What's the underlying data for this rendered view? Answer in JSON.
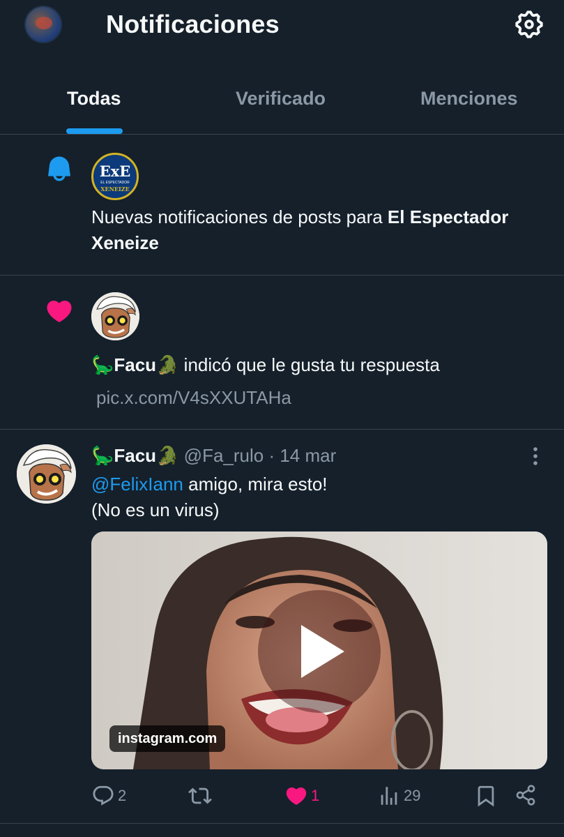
{
  "header": {
    "title": "Notificaciones",
    "avatar_icon": "user-avatar",
    "settings_icon": "gear-icon"
  },
  "tabs": [
    {
      "label": "Todas",
      "active": true
    },
    {
      "label": "Verificado",
      "active": false
    },
    {
      "label": "Menciones",
      "active": false
    }
  ],
  "notifications": [
    {
      "type": "new-posts",
      "icon": "bell-icon",
      "account_logo_text": "ExE",
      "account_logo_small": "EL ESPECTADOR",
      "account_logo_name": "XENEIZE",
      "text_prefix": "Nuevas notificaciones de posts para ",
      "text_account": "El Espectador Xeneize"
    },
    {
      "type": "like",
      "icon": "heart-icon",
      "user_display": "🦕Facu🐊",
      "text": " indicó que le gusta tu respuesta",
      "link": "pic.x.com/V4sXXUTAHa"
    }
  ],
  "tweet": {
    "display_name": "🦕Facu🐊",
    "handle": "@Fa_rulo",
    "separator": " · ",
    "date": "14 mar",
    "mention": "@FelixIann",
    "text_line1": " amigo, mira esto!",
    "text_line2": "(No es un virus)",
    "media_domain": "instagram.com",
    "replies": "2",
    "retweets": "",
    "likes": "1",
    "views": "29"
  },
  "colors": {
    "background": "#15202b",
    "accent": "#1d9bf0",
    "like": "#f91880",
    "muted": "#8b98a5",
    "divider": "#38444d"
  }
}
